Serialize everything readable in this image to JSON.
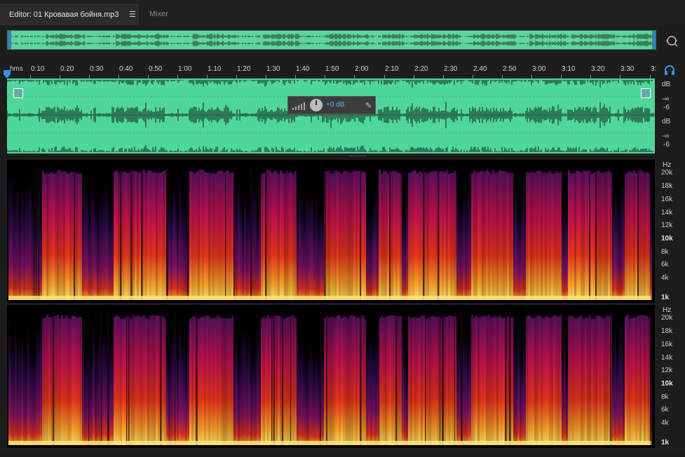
{
  "tabs": {
    "editor_label": "Editor: 01 Кровавая бойня.mp3",
    "mixer_label": "Mixer"
  },
  "ruler": {
    "labels": [
      "hms",
      "0:10",
      "0:20",
      "0:30",
      "0:40",
      "0:50",
      "1:00",
      "1:10",
      "1:20",
      "1:30",
      "1:40",
      "1:50",
      "2:00",
      "2:10",
      "2:20",
      "2:30",
      "2:40",
      "2:50",
      "3:00",
      "3:10",
      "3:20",
      "3:30",
      "3:"
    ]
  },
  "gain_hud": {
    "value": "+0 dB"
  },
  "db_scale": {
    "ch1": [
      "dB",
      "-∞",
      "-6"
    ],
    "ch2": [
      "dB",
      "-∞",
      "-6"
    ]
  },
  "freq_scale": {
    "labels": [
      "Hz",
      "20k",
      "18k",
      "16k",
      "14k",
      "12k",
      "10k",
      "8k",
      "6k",
      "4k",
      "1k"
    ]
  },
  "colors": {
    "waveform_bg": "#4fd79a",
    "accent": "#3b8fe0",
    "hud_value": "#5ab0ff"
  },
  "icons": {
    "zoom": "zoom-icon",
    "listen": "headphones-icon",
    "tab_menu": "menu-icon"
  }
}
